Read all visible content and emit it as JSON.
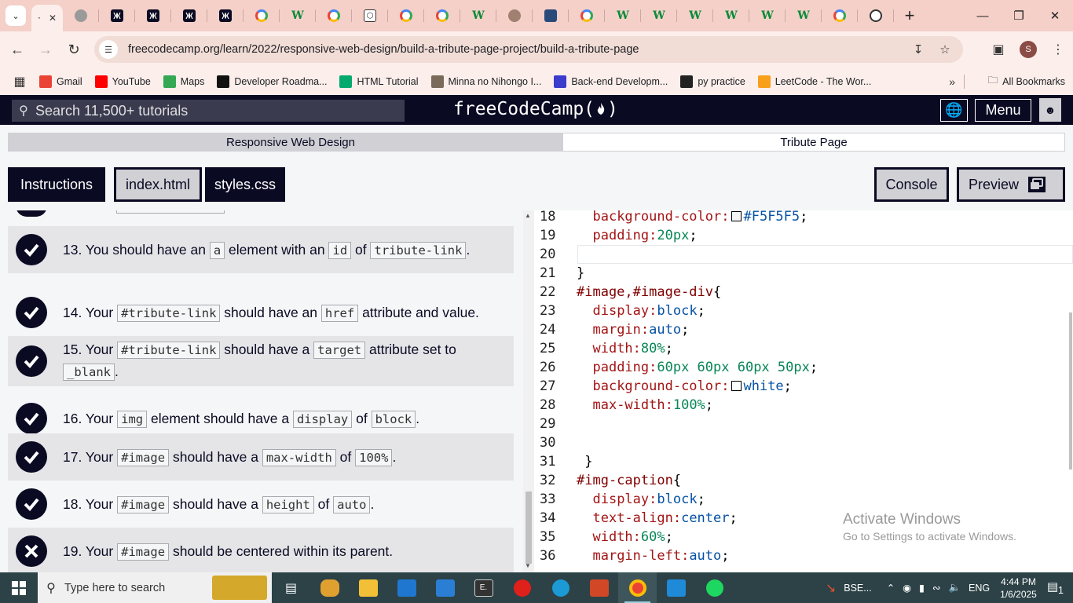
{
  "browser": {
    "url": "freecodecamp.org/learn/2022/responsive-web-design/build-a-tribute-page-project/build-a-tribute-page",
    "tab_favicons": [
      "globe",
      "fcc",
      "fcc",
      "fcc",
      "fcc",
      "g",
      "w",
      "g",
      "cp",
      "g",
      "g",
      "w",
      "brown",
      "blue",
      "g",
      "w",
      "w",
      "w",
      "w",
      "w",
      "w",
      "g",
      "gpt"
    ],
    "profile_initial": "S"
  },
  "bookmarks": [
    {
      "label": "Gmail",
      "color": "#ea4335"
    },
    {
      "label": "YouTube",
      "color": "#ff0000"
    },
    {
      "label": "Maps",
      "color": "#34a853"
    },
    {
      "label": "Developer Roadma...",
      "color": "#111111"
    },
    {
      "label": "HTML Tutorial",
      "color": "#04aa6d"
    },
    {
      "label": "Minna no Nihongo I...",
      "color": "#7a6a5a"
    },
    {
      "label": "Back-end Developm...",
      "color": "#3b3bcc"
    },
    {
      "label": "py practice",
      "color": "#222222"
    },
    {
      "label": "LeetCode - The Wor...",
      "color": "#f89f1b"
    }
  ],
  "bookmarks_all": "All Bookmarks",
  "fcc": {
    "search_placeholder": "Search 11,500+ tutorials",
    "logo": "freeCodeCamp(",
    "logo_end": ")",
    "menu": "Menu"
  },
  "breadcrumb": {
    "course": "Responsive Web Design",
    "project": "Tribute Page"
  },
  "tabs": {
    "instructions": "Instructions",
    "index": "index.html",
    "styles": "styles.css",
    "console": "Console",
    "preview": "Preview"
  },
  "tests": [
    {
      "num": "13.",
      "passed": true,
      "parts": [
        "You should have an ",
        {
          "c": "a"
        },
        " element with an ",
        {
          "c": "id"
        },
        " of ",
        {
          "c": "tribute-link"
        },
        "."
      ]
    },
    {
      "num": "14.",
      "passed": true,
      "parts": [
        "Your ",
        {
          "c": "#tribute-link"
        },
        " should have an ",
        {
          "c": "href"
        },
        " attribute and value."
      ]
    },
    {
      "num": "15.",
      "passed": true,
      "parts": [
        "Your ",
        {
          "c": "#tribute-link"
        },
        " should have a ",
        {
          "c": "target"
        },
        " attribute set to ",
        {
          "c": "_blank"
        },
        "."
      ]
    },
    {
      "num": "16.",
      "passed": true,
      "parts": [
        "Your ",
        {
          "c": "img"
        },
        " element should have a ",
        {
          "c": "display"
        },
        " of ",
        {
          "c": "block"
        },
        "."
      ]
    },
    {
      "num": "17.",
      "passed": true,
      "parts": [
        "Your ",
        {
          "c": "#image"
        },
        " should have a ",
        {
          "c": "max-width"
        },
        " of ",
        {
          "c": "100%"
        },
        "."
      ]
    },
    {
      "num": "18.",
      "passed": true,
      "parts": [
        "Your ",
        {
          "c": "#image"
        },
        " should have a ",
        {
          "c": "height"
        },
        " of ",
        {
          "c": "auto"
        },
        "."
      ]
    },
    {
      "num": "19.",
      "passed": false,
      "parts": [
        "Your ",
        {
          "c": "#image"
        },
        " should be centered within its parent."
      ]
    }
  ],
  "code_lines": [
    {
      "n": "18",
      "t": [
        [
          "  ",
          ""
        ],
        [
          "background-color:",
          "kw"
        ],
        [
          "#swatch#f5f5f5",
          ""
        ],
        [
          "#F5F5F5",
          "val"
        ],
        [
          ";",
          "pn"
        ]
      ]
    },
    {
      "n": "19",
      "t": [
        [
          "  ",
          ""
        ],
        [
          "padding:",
          "kw"
        ],
        [
          "20px",
          "num"
        ],
        [
          ";",
          "pn"
        ]
      ]
    },
    {
      "n": "20",
      "t": []
    },
    {
      "n": "21",
      "t": [
        [
          "}",
          "pn"
        ]
      ]
    },
    {
      "n": "22",
      "t": [
        [
          "#image,#image-div",
          "sel-c"
        ],
        [
          "{",
          "pn"
        ]
      ]
    },
    {
      "n": "23",
      "t": [
        [
          "  ",
          ""
        ],
        [
          "display:",
          "kw"
        ],
        [
          "block",
          "val"
        ],
        [
          ";",
          "pn"
        ]
      ]
    },
    {
      "n": "24",
      "t": [
        [
          "  ",
          ""
        ],
        [
          "margin:",
          "kw"
        ],
        [
          "auto",
          "val"
        ],
        [
          ";",
          "pn"
        ]
      ]
    },
    {
      "n": "25",
      "t": [
        [
          "  ",
          ""
        ],
        [
          "width:",
          "kw"
        ],
        [
          "80%",
          "num"
        ],
        [
          ";",
          "pn"
        ]
      ]
    },
    {
      "n": "26",
      "t": [
        [
          "  ",
          ""
        ],
        [
          "padding:",
          "kw"
        ],
        [
          "60px 60px 60px 50px",
          "num"
        ],
        [
          ";",
          "pn"
        ]
      ]
    },
    {
      "n": "27",
      "t": [
        [
          "  ",
          ""
        ],
        [
          "background-color:",
          "kw"
        ],
        [
          "#swatch#ffffff",
          ""
        ],
        [
          "white",
          "val"
        ],
        [
          ";",
          "pn"
        ]
      ]
    },
    {
      "n": "28",
      "t": [
        [
          "  ",
          ""
        ],
        [
          "max-width:",
          "kw"
        ],
        [
          "100%",
          "num"
        ],
        [
          ";",
          "pn"
        ]
      ]
    },
    {
      "n": "29",
      "t": []
    },
    {
      "n": "30",
      "t": []
    },
    {
      "n": "31",
      "t": [
        [
          " }",
          "pn"
        ]
      ]
    },
    {
      "n": "32",
      "t": [
        [
          "#img-caption",
          "sel-c"
        ],
        [
          "{",
          "pn"
        ]
      ]
    },
    {
      "n": "33",
      "t": [
        [
          "  ",
          ""
        ],
        [
          "display:",
          "kw"
        ],
        [
          "block",
          "val"
        ],
        [
          ";",
          "pn"
        ]
      ]
    },
    {
      "n": "34",
      "t": [
        [
          "  ",
          ""
        ],
        [
          "text-align:",
          "kw"
        ],
        [
          "center",
          "val"
        ],
        [
          ";",
          "pn"
        ]
      ]
    },
    {
      "n": "35",
      "t": [
        [
          "  ",
          ""
        ],
        [
          "width:",
          "kw"
        ],
        [
          "60%",
          "num"
        ],
        [
          ";",
          "pn"
        ]
      ]
    },
    {
      "n": "36",
      "t": [
        [
          "  ",
          ""
        ],
        [
          "margin-left:",
          "kw"
        ],
        [
          "auto",
          "val"
        ],
        [
          ";",
          "pn"
        ]
      ]
    }
  ],
  "watermark": {
    "line1": "Activate Windows",
    "line2": "Go to Settings to activate Windows."
  },
  "taskbar": {
    "search_placeholder": "Type here to search",
    "tray_app": "BSE...",
    "lang": "ENG",
    "time": "4:44 PM",
    "date": "1/6/2025",
    "notifications": "1"
  },
  "colors": {
    "fcc_dark": "#0a0a23",
    "tab_strip": "#f4d0c8",
    "toolbar": "#fbeeeb"
  }
}
